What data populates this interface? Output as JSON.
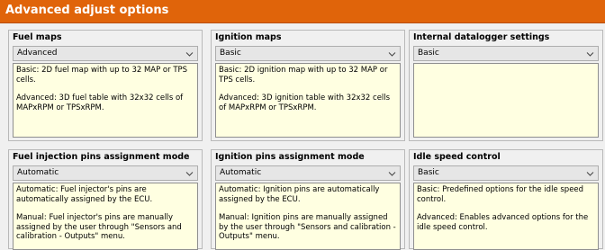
{
  "window": {
    "title": "Advanced adjust options"
  },
  "panels": [
    {
      "title": "Fuel maps",
      "selected": "Advanced",
      "description": [
        "Basic: 2D fuel map with up to 32 MAP or TPS cells.",
        "Advanced: 3D fuel table with 32x32 cells of MAPxRPM or TPSxRPM."
      ]
    },
    {
      "title": "Ignition maps",
      "selected": "Basic",
      "description": [
        "Basic: 2D ignition map with up to 32 MAP or TPS cells.",
        "Advanced: 3D ignition table with 32x32 cells of MAPxRPM or TPSxRPM."
      ]
    },
    {
      "title": "Internal datalogger settings",
      "selected": "Basic",
      "description": []
    },
    {
      "title": "Fuel injection pins assignment mode",
      "selected": "Automatic",
      "description": [
        "Automatic: Fuel injector's pins are automatically assigned by the ECU.",
        "Manual: Fuel injector's pins are manually assigned by the user through \"Sensors and calibration - Outputs\" menu."
      ]
    },
    {
      "title": "Ignition pins assignment mode",
      "selected": "Automatic",
      "description": [
        "Automatic: Ignition pins are automatically assigned by the ECU.",
        "Manual: Ignition pins are manually assigned by the user through \"Sensors and calibration - Outputs\" menu."
      ]
    },
    {
      "title": "Idle speed control",
      "selected": "Basic",
      "description": [
        "Basic: Predefined options for the idle speed control.",
        "Advanced: Enables advanced options for the idle speed control."
      ]
    }
  ],
  "icons": {
    "dropdown": "chevron-down-icon"
  },
  "colors": {
    "title_bar": "#e0640a",
    "title_text": "#ffffff",
    "description_bg": "#ffffe1",
    "panel_bg": "#f0f0f0"
  }
}
